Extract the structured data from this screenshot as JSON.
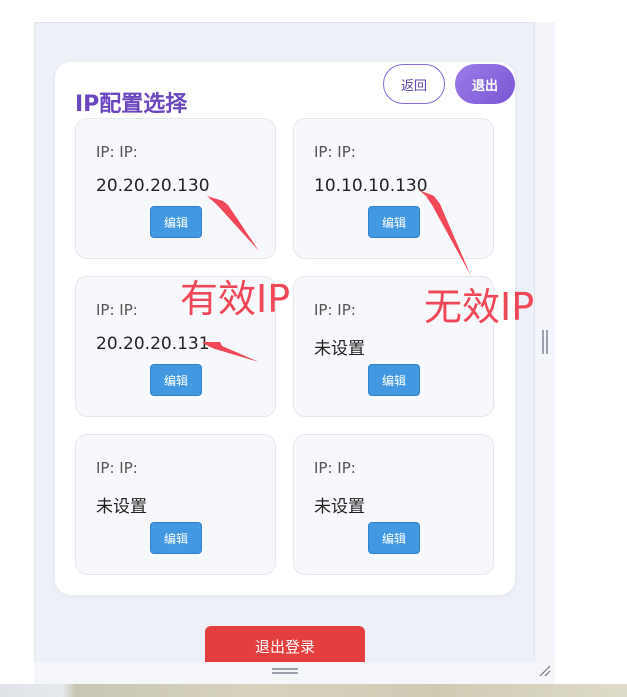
{
  "header": {
    "title": "IP配置选择",
    "back_label": "返回",
    "exit_label": "退出"
  },
  "cards": [
    {
      "label": "IP: IP:",
      "value": "20.20.20.130",
      "edit_label": "编辑"
    },
    {
      "label": "IP: IP:",
      "value": "10.10.10.130",
      "edit_label": "编辑"
    },
    {
      "label": "IP: IP:",
      "value": "20.20.20.131",
      "edit_label": "编辑"
    },
    {
      "label": "IP: IP:",
      "value": "未设置",
      "edit_label": "编辑"
    },
    {
      "label": "IP: IP:",
      "value": "未设置",
      "edit_label": "编辑"
    },
    {
      "label": "IP: IP:",
      "value": "未设置",
      "edit_label": "编辑"
    }
  ],
  "footer": {
    "logout_label": "退出登录"
  },
  "annotations": {
    "valid_ip": "有效IP",
    "invalid_ip": "无效IP"
  },
  "colors": {
    "accent": "#6b46c1",
    "edit": "#4299e1",
    "logout": "#e53e3e",
    "annotation": "#f04858"
  }
}
